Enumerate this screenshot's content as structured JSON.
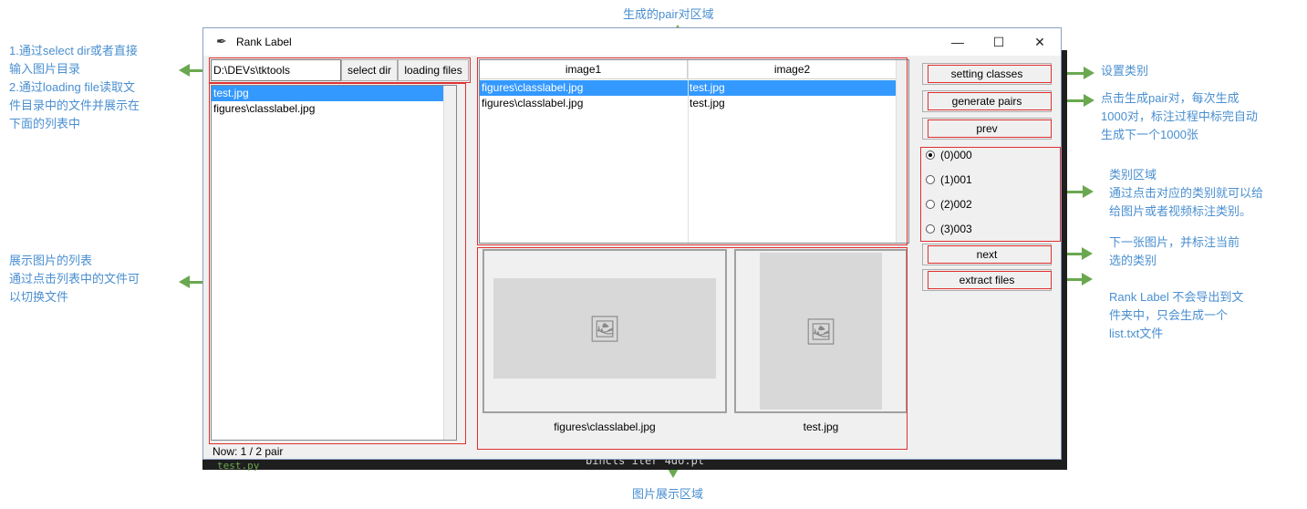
{
  "annotations": {
    "top": "生成的pair对区域",
    "bottom": "图片展示区域",
    "left_top": "1.通过select dir或者直接\n输入图片目录\n2.通过loading file读取文\n件目录中的文件并展示在\n下面的列表中",
    "left_mid": "展示图片的列表\n通过点击列表中的文件可\n以切换文件",
    "r_classes": "设置类别",
    "r_generate": "点击生成pair对，每次生成\n1000对，标注过程中标完自动\n生成下一个1000张",
    "r_category": "类别区域\n通过点击对应的类别就可以给\n给图片或者视频标注类别。",
    "r_next": "下一张图片，并标注当前\n选的类别",
    "r_extract": "Rank Label 不会导出到文\n件夹中，只会生成一个\nlist.txt文件"
  },
  "window": {
    "title": "Rank Label",
    "minimize": "—",
    "maximize": "☐",
    "close": "✕"
  },
  "dir": {
    "path": "D:\\DEVs\\tktools",
    "select_label": "select dir",
    "loading_label": "loading files"
  },
  "file_list": [
    "test.jpg",
    "figures\\classlabel.jpg"
  ],
  "pairs": {
    "headers": [
      "image1",
      "image2"
    ],
    "rows": [
      [
        "figures\\classlabel.jpg",
        "test.jpg"
      ],
      [
        "figures\\classlabel.jpg",
        "test.jpg"
      ]
    ]
  },
  "preview": {
    "left_caption": "figures\\classlabel.jpg",
    "right_caption": "test.jpg"
  },
  "buttons": {
    "setting": "setting classes",
    "generate": "generate pairs",
    "prev": "prev",
    "next": "next",
    "extract": "extract files"
  },
  "classes": [
    "(0)000",
    "(1)001",
    "(2)002",
    "(3)003"
  ],
  "status": "Now: 1 / 2 pair",
  "editor": {
    "code": "bincls iter 4do.pt",
    "code2": "test.py"
  }
}
